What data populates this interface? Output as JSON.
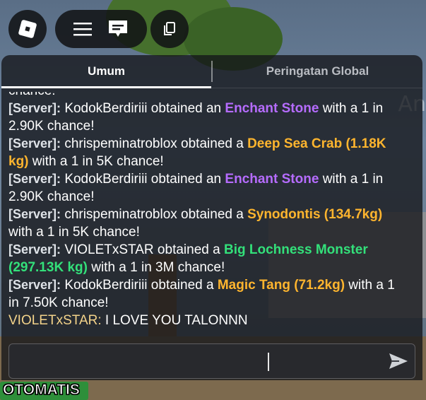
{
  "tabs": [
    {
      "label": "Umum",
      "active": true
    },
    {
      "label": "Peringatan Global",
      "active": false
    }
  ],
  "messages": {
    "top_partial": "chance!",
    "m1": {
      "tag": "[Server]:",
      "pre": "KodokBerdiriii obtained an ",
      "item": "Enchant Stone",
      "post": " with a 1 in 2.90K chance!"
    },
    "m2": {
      "tag": "[Server]:",
      "pre": "chrispeminatroblox obtained a ",
      "item": "Deep Sea Crab (1.18K kg)",
      "post": " with a 1 in 5K chance!"
    },
    "m3": {
      "tag": "[Server]:",
      "pre": "KodokBerdiriii obtained an ",
      "item": "Enchant Stone",
      "post": " with a 1 in 2.90K chance!"
    },
    "m4": {
      "tag": "[Server]:",
      "pre": "chrispeminatroblox obtained a ",
      "item": "Synodontis (134.7kg)",
      "post": " with a 1 in 5K chance!"
    },
    "m5": {
      "tag": "[Server]:",
      "pre": "VIOLETxSTAR obtained a ",
      "item": "Big Lochness Monster (297.13K kg)",
      "post": " with a 1 in 3M chance!"
    },
    "m6": {
      "tag": "[Server]:",
      "pre": "KodokBerdiriii obtained a ",
      "item": "Magic Tang (71.2kg)",
      "post": " with a 1 in 7.50K chance!"
    },
    "user": {
      "name": "VIOLETxSTAR:",
      "text": " I LOVE YOU TALONNN"
    }
  },
  "input": {
    "value": ""
  },
  "bottom_label": "OTOMATIS",
  "background_text": "An",
  "colors": {
    "purple": "#b66cff",
    "orange": "#ffb52e",
    "green": "#33e07a"
  },
  "icons": [
    "roblox-logo-icon",
    "menu-icon",
    "chat-icon",
    "copy-icon",
    "send-icon"
  ]
}
